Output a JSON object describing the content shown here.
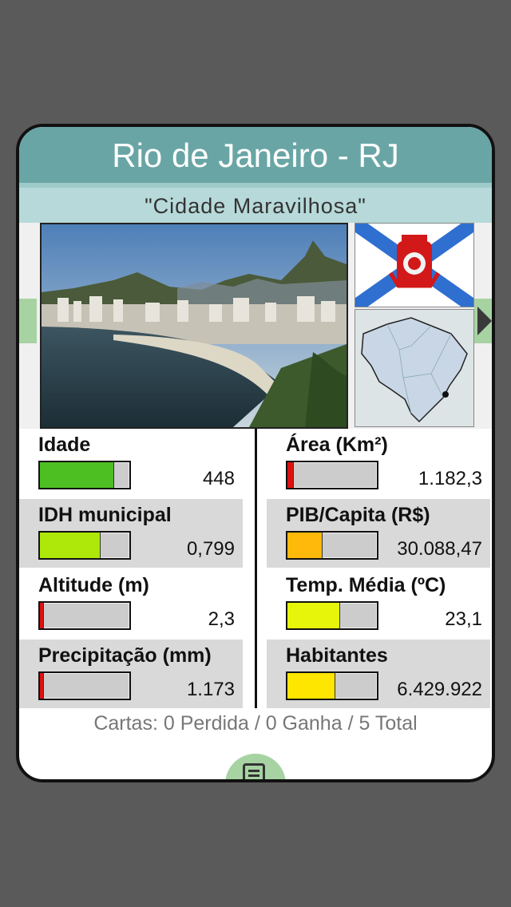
{
  "card": {
    "title": "Rio de Janeiro - RJ",
    "subtitle": "\"Cidade Maravilhosa\""
  },
  "images": {
    "photo": "rio-photo",
    "flag": "rio-flag",
    "map": "brazil-map"
  },
  "stats": [
    {
      "label": "Idade",
      "value": "448",
      "level": 0.82,
      "color": "#4dbf23"
    },
    {
      "label": "Área (Km²)",
      "value": "1.182,3",
      "level": 0.06,
      "color": "#dd1111"
    },
    {
      "label": "IDH municipal",
      "value": "0,799",
      "level": 0.67,
      "color": "#aee80a"
    },
    {
      "label": "PIB/Capita (R$)",
      "value": "30.088,47",
      "level": 0.38,
      "color": "#ffb90a"
    },
    {
      "label": "Altitude (m)",
      "value": "2,3",
      "level": 0.04,
      "color": "#dd1111"
    },
    {
      "label": "Temp. Média (ºC)",
      "value": "23,1",
      "level": 0.58,
      "color": "#e6f50a"
    },
    {
      "label": "Precipitação (mm)",
      "value": "1.173",
      "level": 0.04,
      "color": "#dd1111"
    },
    {
      "label": "Habitantes",
      "value": "6.429.922",
      "level": 0.53,
      "color": "#ffe600"
    }
  ],
  "footer": {
    "summary": "Cartas: 0 Perdida / 0 Ganha / 5 Total"
  },
  "icons": {
    "menu": "document-icon",
    "next": "arrow-right-icon"
  }
}
